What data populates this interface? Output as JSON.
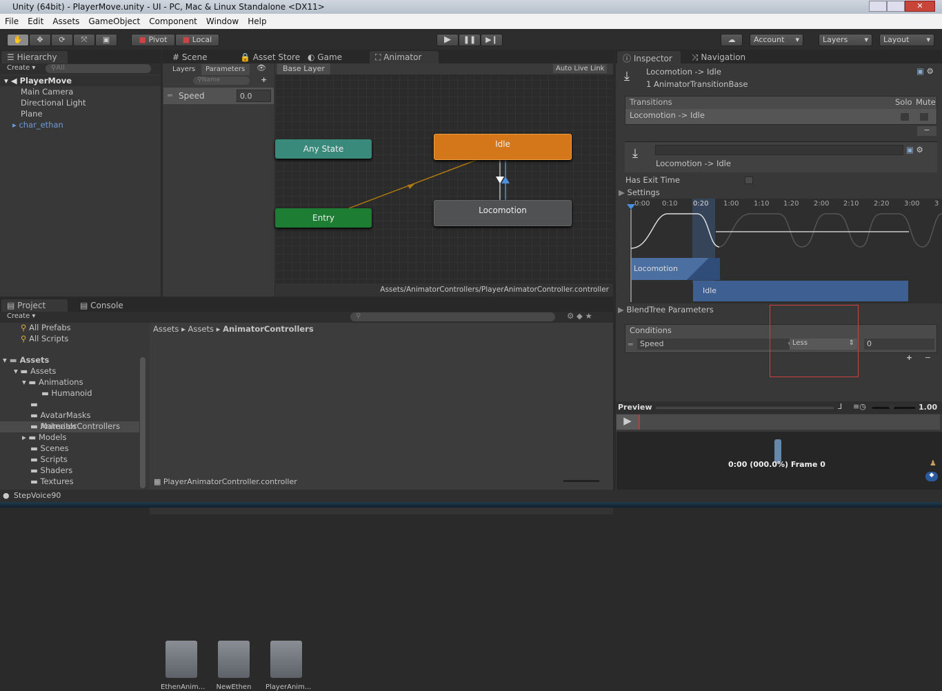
{
  "window": {
    "title": "Unity (64bit) - PlayerMove.unity - UI - PC, Mac & Linux Standalone <DX11>"
  },
  "menu": [
    "File",
    "Edit",
    "Assets",
    "GameObject",
    "Component",
    "Window",
    "Help"
  ],
  "toolbar": {
    "pivot": "Pivot",
    "local": "Local",
    "account": "Account",
    "layers": "Layers",
    "layout": "Layout"
  },
  "hierarchy": {
    "tab": "Hierarchy",
    "create": "Create",
    "search_placeholder": "All",
    "scene": "PlayerMove",
    "items": [
      "Main Camera",
      "Directional Light",
      "Plane",
      "char_ethan"
    ]
  },
  "center_tabs": [
    "Scene",
    "Asset Store",
    "Game",
    "Animator"
  ],
  "animator": {
    "layers_tab": "Layers",
    "parameters_tab": "Parameters",
    "search_placeholder": "Name",
    "param_name": "Speed",
    "param_value": "0.0",
    "breadcrumb": "Base Layer",
    "auto_live_link": "Auto Live Link",
    "path": "Assets/AnimatorControllers/PlayerAnimatorController.controller",
    "nodes": {
      "any_state": "Any State",
      "entry": "Entry",
      "idle": "Idle",
      "locomotion": "Locomotion"
    },
    "colors": {
      "idle": "#d4761a",
      "entry": "#1c7d33",
      "any_state": "#3a8a7c",
      "locomotion": "#4f5152"
    }
  },
  "project": {
    "tab": "Project",
    "console_tab": "Console",
    "create": "Create",
    "favorites": [
      "All Prefabs",
      "All Scripts"
    ],
    "root": "Assets",
    "tree": [
      "Assets",
      "Animations",
      "Humanoid",
      "AnimatorControllers",
      "AvatarMasks",
      "Materials",
      "Models",
      "Scenes",
      "Scripts",
      "Shaders",
      "Textures"
    ],
    "breadcrumb": [
      "Assets",
      "Assets",
      "AnimatorControllers"
    ],
    "assets": [
      "EthenAnim...",
      "NewEthen",
      "PlayerAnim..."
    ],
    "selected_file": "PlayerAnimatorController.controller"
  },
  "inspector": {
    "tab": "Inspector",
    "nav_tab": "Navigation",
    "title": "Locomotion -> Idle",
    "subtitle": "1 AnimatorTransitionBase",
    "transitions_header": "Transitions",
    "solo": "Solo",
    "mute": "Mute",
    "transition_item": "Locomotion -> Idle",
    "transition_name": "Locomotion -> Idle",
    "has_exit_time": "Has Exit Time",
    "settings": "Settings",
    "timeline_ticks": [
      "0:00",
      "0:10",
      "0:20",
      "1:00",
      "1:10",
      "1:20",
      "2:00",
      "2:10",
      "2:20",
      "3:00",
      "3"
    ],
    "clip_from": "Locomotion",
    "clip_to": "Idle",
    "blendtree": "BlendTree Parameters",
    "conditions": "Conditions",
    "cond_param": "Speed",
    "cond_op": "Less",
    "cond_value": "0",
    "preview": "Preview",
    "speed": "1.00",
    "frame": "0:00 (000.0%) Frame 0"
  },
  "status": {
    "text": "StepVoice90"
  }
}
